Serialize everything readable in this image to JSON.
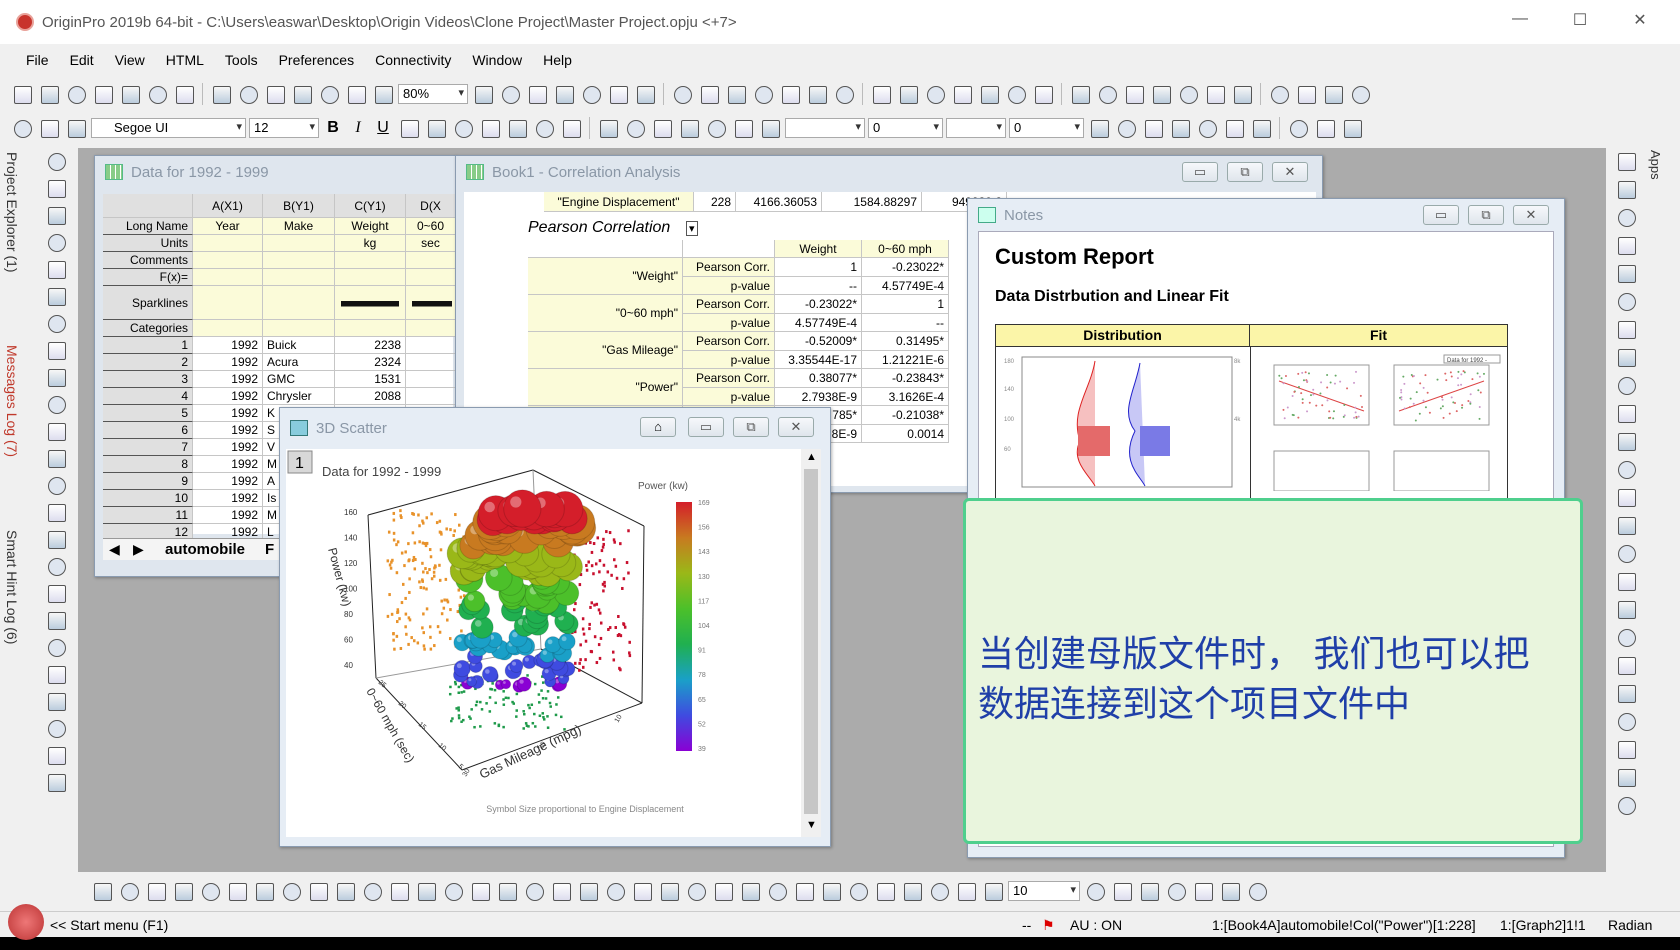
{
  "titlebar": {
    "title": "OriginPro 2019b 64-bit - C:\\Users\\easwar\\Desktop\\Origin Videos\\Clone Project\\Master Project.opju <+7>",
    "minimize": "—",
    "maximize": "☐",
    "close": "✕"
  },
  "menu": [
    "File",
    "Edit",
    "View",
    "HTML",
    "Tools",
    "Preferences",
    "Connectivity",
    "Window",
    "Help"
  ],
  "toolbar": {
    "zoom_value": "80%",
    "font_name": "Segoe UI",
    "font_size": "12",
    "bold": "B",
    "italic": "I",
    "underline": "U",
    "line_width": "0",
    "pattern": "0",
    "pattern_size": "10"
  },
  "left_tabs": [
    "Project Explorer (1)",
    "Messages Log (7)",
    "Smart Hint Log (6)"
  ],
  "apps_tab": "Apps",
  "data_window": {
    "title": "Data for 1992 - 1999",
    "columns": [
      "A(X1)",
      "B(Y1)",
      "C(Y1)",
      "D(X"
    ],
    "meta_rows": [
      {
        "label": "Long Name",
        "values": [
          "Year",
          "Make",
          "Weight",
          "0~60"
        ]
      },
      {
        "label": "Units",
        "values": [
          "",
          "",
          "kg",
          "sec"
        ]
      },
      {
        "label": "Comments",
        "values": [
          "",
          "",
          "",
          ""
        ]
      },
      {
        "label": "F(x)=",
        "values": [
          "",
          "",
          "",
          ""
        ]
      },
      {
        "label": "Sparklines",
        "values": [
          "",
          "",
          "",
          ""
        ]
      },
      {
        "label": "Categories",
        "values": [
          "",
          "",
          "",
          ""
        ]
      }
    ],
    "rows": [
      [
        "1",
        "1992",
        "Buick",
        "2238"
      ],
      [
        "2",
        "1992",
        "Acura",
        "2324"
      ],
      [
        "3",
        "1992",
        "GMC",
        "1531"
      ],
      [
        "4",
        "1992",
        "Chrysler",
        "2088"
      ],
      [
        "5",
        "1992",
        "K",
        ""
      ],
      [
        "6",
        "1992",
        "S",
        ""
      ],
      [
        "7",
        "1992",
        "V",
        ""
      ],
      [
        "8",
        "1992",
        "M",
        ""
      ],
      [
        "9",
        "1992",
        "A",
        ""
      ],
      [
        "10",
        "1992",
        "Is",
        ""
      ],
      [
        "11",
        "1992",
        "M",
        ""
      ],
      [
        "12",
        "1992",
        "L",
        ""
      ]
    ],
    "sheet_tab": "automobile",
    "sheet_tab2": "F"
  },
  "corr_window": {
    "title": "Book1 - Correlation Analysis",
    "top_row": [
      "\"Engine Displacement\"",
      "228",
      "4166.36053",
      "1584.88297",
      "949930.2"
    ],
    "section": "Pearson Correlation",
    "columns": [
      "Weight",
      "0~60 mph"
    ],
    "groups": [
      {
        "name": "\"Weight\"",
        "corr": [
          "1",
          "-0.23022*"
        ],
        "p": [
          "--",
          "4.57749E-4"
        ]
      },
      {
        "name": "\"0~60 mph\"",
        "corr": [
          "-0.23022*",
          "1"
        ],
        "p": [
          "4.57749E-4",
          "--"
        ]
      },
      {
        "name": "\"Gas Mileage\"",
        "corr": [
          "-0.52009*",
          "0.31495*"
        ],
        "p": [
          "3.35544E-17",
          "1.21221E-6"
        ]
      },
      {
        "name": "\"Power\"",
        "corr": [
          "0.38077*",
          "-0.23843*"
        ],
        "p": [
          "2.7938E-9",
          "3.1626E-4"
        ]
      },
      {
        "name": "",
        "corr": [
          "785*",
          "-0.21038*"
        ],
        "p": [
          "8E-9",
          "0.0014"
        ]
      }
    ],
    "corr_label": "Pearson Corr.",
    "p_label": "p-value"
  },
  "notes_window": {
    "title": "Notes",
    "heading": "Custom Report",
    "subheading": "Data Distrbution and Linear Fit",
    "table_headers": [
      "Distribution",
      "Fit"
    ],
    "thumb_label": "Data for 1992 -"
  },
  "scatter_window": {
    "title": "3D Scatter",
    "layer": "1"
  },
  "chart_data": {
    "type": "scatter3d",
    "title": "Data for 1992 - 1999",
    "zlabel": "Power (kw)",
    "ylabel": "0~60 mph (sec)",
    "xlabel": "Gas Mileage (mpg)",
    "z_ticks": [
      "40",
      "60",
      "80",
      "100",
      "120",
      "140",
      "160"
    ],
    "y_ticks": [
      "5",
      "10",
      "15",
      "20",
      "25"
    ],
    "x_ticks": [
      "30",
      "20",
      "10"
    ],
    "colorbar_title": "Power (kw)",
    "colorbar_ticks": [
      "169",
      "156",
      "143",
      "130",
      "117",
      "104",
      "91",
      "78",
      "65",
      "52",
      "39"
    ],
    "colorbar_range": [
      39,
      169
    ],
    "colormap": [
      "#8a00d4",
      "#3f4be0",
      "#1aa0c8",
      "#20b050",
      "#4cc02a",
      "#9ab818",
      "#c87a20",
      "#d41e2a"
    ],
    "projection_colors": {
      "side_left": "#e8922a",
      "side_right": "#c8102e",
      "bottom": "#1e9a4a"
    },
    "footnote": "Symbol Size proportional to Engine Displacement"
  },
  "overlay": {
    "line1": "当创建母版文件时， 我们也可以把",
    "line2": "数据连接到这个项目文件中"
  },
  "statusbar": {
    "start_menu": "<< Start menu (F1)",
    "dash": "--",
    "au": "AU : ON",
    "active_col": "1:[Book4A]automobile!Col(\"Power\")[1:228]",
    "graph": "1:[Graph2]1!1",
    "angle": "Radian"
  }
}
